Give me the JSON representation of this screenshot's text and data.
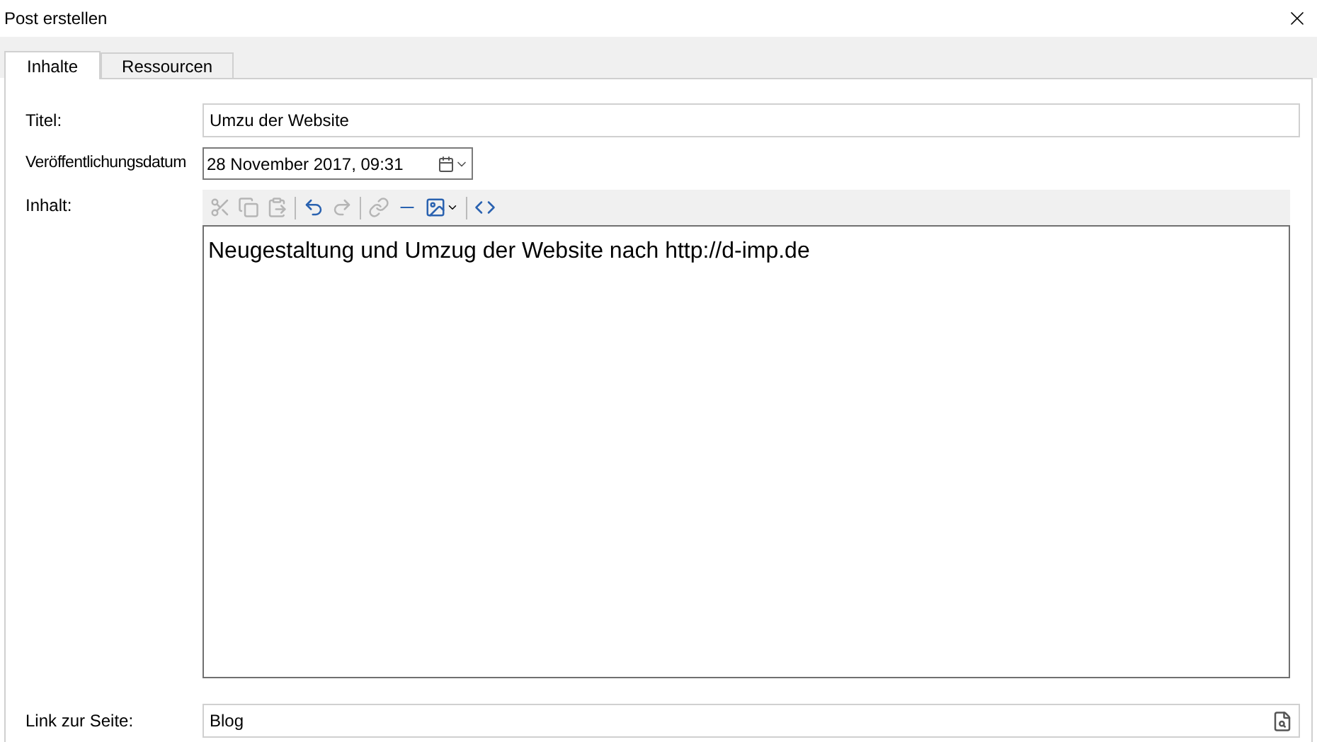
{
  "window": {
    "title": "Post erstellen"
  },
  "tabs": [
    {
      "label": "Inhalte",
      "selected": true
    },
    {
      "label": "Ressourcen",
      "selected": false
    }
  ],
  "form": {
    "title_label": "Titel:",
    "title_value": "Umzu der Website",
    "date_label": "Veröffentlichungsdatum",
    "date_value": "28 November 2017, 09:31",
    "content_label": "Inhalt:",
    "content_text": "Neugestaltung und Umzug der Website nach http://d-imp.de",
    "link_label": "Link zur Seite:",
    "link_value": "Blog"
  },
  "toolbar": [
    {
      "kind": "cut",
      "disabled": true
    },
    {
      "kind": "copy",
      "disabled": true
    },
    {
      "kind": "paste",
      "disabled": true
    },
    {
      "kind": "separator"
    },
    {
      "kind": "undo",
      "disabled": false
    },
    {
      "kind": "redo",
      "disabled": true
    },
    {
      "kind": "separator"
    },
    {
      "kind": "link",
      "disabled": true
    },
    {
      "kind": "rule",
      "disabled": false
    },
    {
      "kind": "image",
      "disabled": false
    },
    {
      "kind": "separator"
    },
    {
      "kind": "source",
      "disabled": false
    }
  ]
}
